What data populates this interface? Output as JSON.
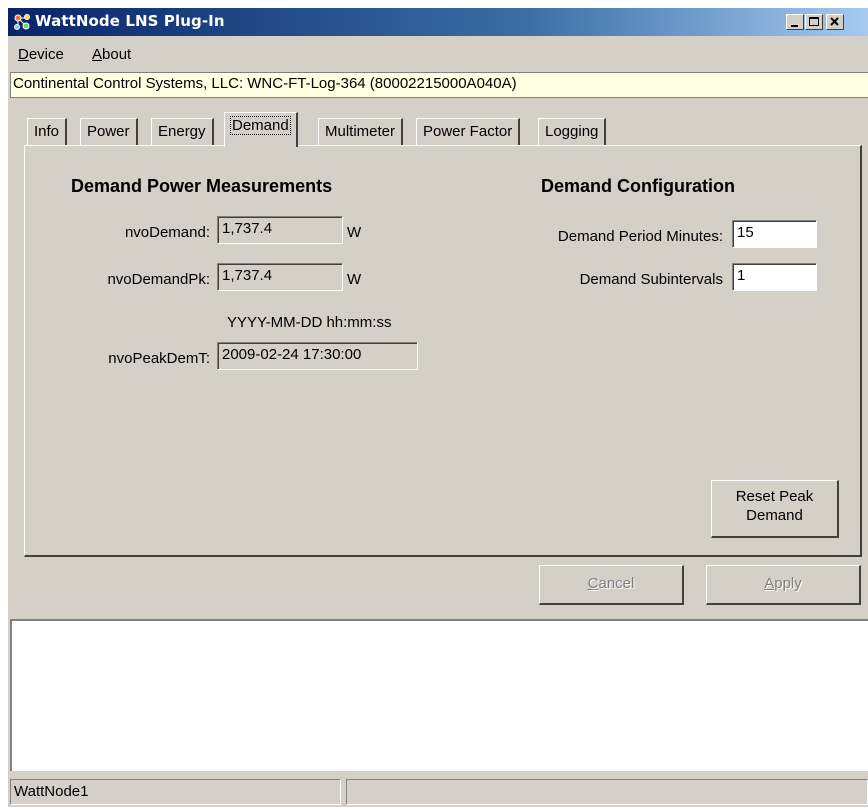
{
  "window": {
    "title": "WattNode LNS Plug-In"
  },
  "menu": {
    "items": [
      {
        "label": "Device",
        "accel": "D",
        "rest": "evice"
      },
      {
        "label": "About",
        "accel": "A",
        "rest": "bout"
      }
    ]
  },
  "device_info": "Continental Control Systems, LLC: WNC-FT-Log-364 (80002215000A040A)",
  "tabs": [
    "Info",
    "Power",
    "Energy",
    "Demand",
    "Multimeter",
    "Power Factor",
    "Logging"
  ],
  "active_tab": "Demand",
  "demand": {
    "heading": "Demand Power Measurements",
    "nvoDemand": {
      "label": "nvoDemand:",
      "value": "1,737.4",
      "unit": "W"
    },
    "nvoDemandPk": {
      "label": "nvoDemandPk:",
      "value": "1,737.4",
      "unit": "W"
    },
    "date_format": "YYYY-MM-DD hh:mm:ss",
    "nvoPeakDemT": {
      "label": "nvoPeakDemT:",
      "value": "2009-02-24 17:30:00"
    }
  },
  "config": {
    "heading": "Demand Configuration",
    "period": {
      "label": "Demand Period Minutes:",
      "value": "15"
    },
    "subintervals": {
      "label": "Demand Subintervals",
      "value": "1"
    }
  },
  "buttons": {
    "reset_line1": "Reset Peak",
    "reset_line2": "Demand",
    "cancel": {
      "accel": "C",
      "rest": "ancel"
    },
    "apply": {
      "accel": "A",
      "rest": "pply"
    }
  },
  "status": {
    "pane1": "WattNode1",
    "pane2": ""
  },
  "colors": {
    "title_start": "#0a246a",
    "title_end": "#a6caf0",
    "face": "#d4d0c8",
    "device_bar": "#ffffe1"
  },
  "icons": {
    "app": "network-nodes-icon",
    "minimize": "minimize-icon",
    "maximize": "maximize-icon",
    "close": "close-icon"
  }
}
